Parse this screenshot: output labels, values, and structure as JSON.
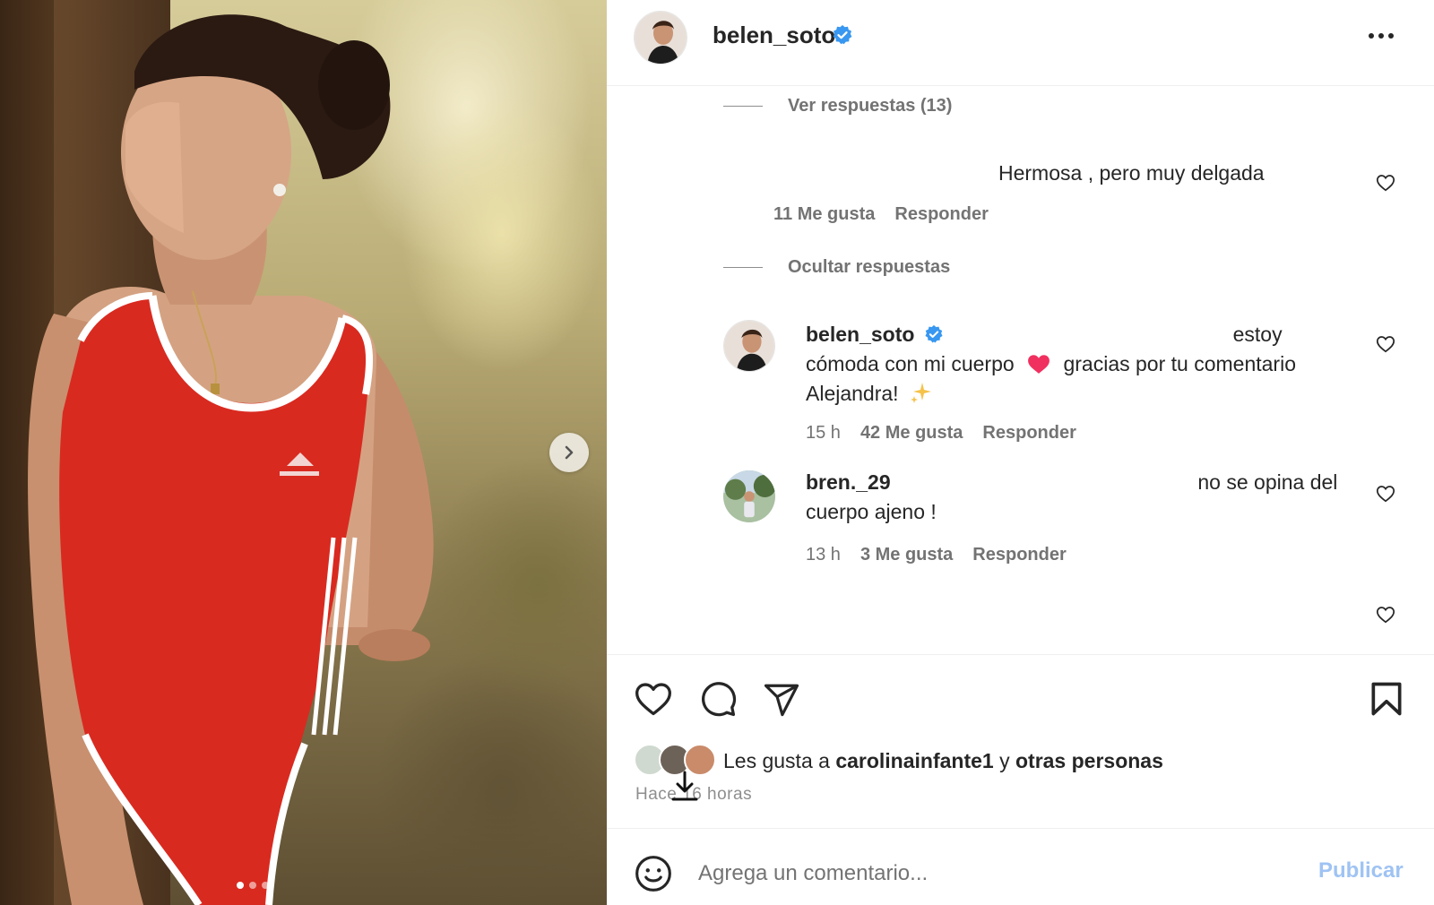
{
  "post": {
    "carousel": {
      "slide_count": 3,
      "active_slide": 1
    }
  },
  "header": {
    "username": "belen_soto",
    "verified": true,
    "more_icon": "more-horizontal-icon"
  },
  "thread": {
    "view_replies": "Ver respuestas (13)",
    "comment1": {
      "text": "Hermosa , pero muy delgada",
      "likes": "11 Me gusta",
      "reply": "Responder"
    },
    "hide_replies": "Ocultar respuestas",
    "reply1": {
      "username": "belen_soto",
      "text_a": "estoy",
      "text_b": "cómoda con mi cuerpo",
      "text_c": "gracias por tu comentario",
      "text_d": "Alejandra!",
      "time": "15 h",
      "likes": "42 Me gusta",
      "reply": "Responder"
    },
    "reply2": {
      "username": "bren._29",
      "text_a": "no se opina del",
      "text_b": "cuerpo ajeno !",
      "time": "13 h",
      "likes": "3 Me gusta",
      "reply": "Responder"
    }
  },
  "actions": {
    "like_icon": "heart-icon",
    "comment_icon": "comment-icon",
    "share_icon": "send-icon",
    "save_icon": "bookmark-icon"
  },
  "likes": {
    "prefix": "Les gusta a",
    "user": "carolinainfante1",
    "joiner": "y",
    "others": "otras personas"
  },
  "time_ago": "Hace 16 horas",
  "composer": {
    "placeholder": "Agrega un comentario...",
    "publish": "Publicar"
  },
  "colors": {
    "verified": "#3897f0",
    "publish_disabled": "#9fc3f3",
    "swimsuit": "#d92a20"
  }
}
